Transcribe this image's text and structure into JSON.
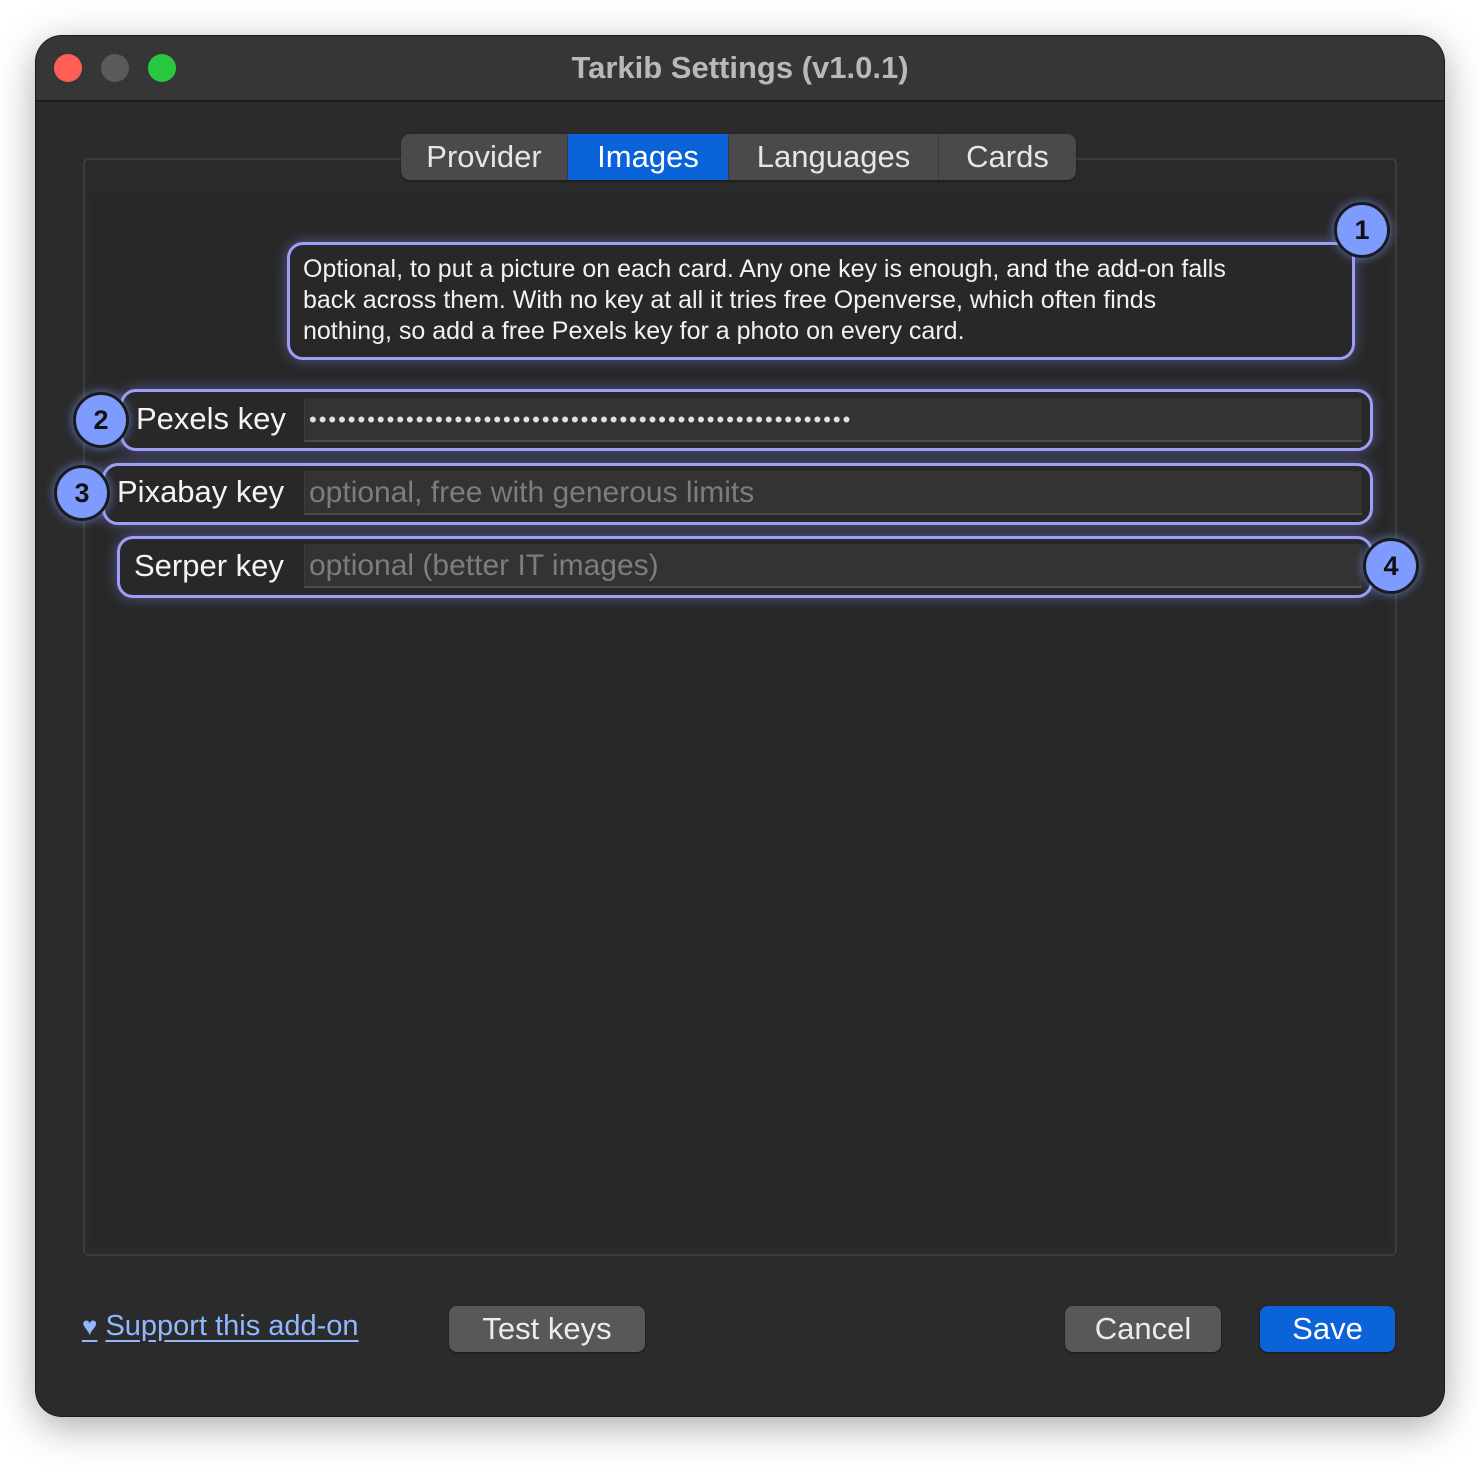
{
  "window": {
    "title": "Tarkib Settings (v1.0.1)"
  },
  "tabs": [
    {
      "label": "Provider",
      "active": false
    },
    {
      "label": "Images",
      "active": true
    },
    {
      "label": "Languages",
      "active": false
    },
    {
      "label": "Cards",
      "active": false
    }
  ],
  "images_tab": {
    "info": "Optional, to put a picture on each card. Any one key is enough, and the add-on falls\nback across them. With no key at all it tries free Openverse, which often finds\nnothing, so add a free Pexels key for a photo on every card.",
    "fields": {
      "pexels": {
        "label": "Pexels key",
        "value": "••••••••••••••••••••••••••••••••••••••••••••••••••••••••",
        "placeholder": ""
      },
      "pixabay": {
        "label": "Pixabay key",
        "value": "",
        "placeholder": "optional, free with generous limits"
      },
      "serper": {
        "label": "Serper key",
        "value": "",
        "placeholder": "optional (better IT images)"
      }
    }
  },
  "annotations": [
    "1",
    "2",
    "3",
    "4"
  ],
  "footer": {
    "support_link": "Support this add-on",
    "support_icon": "heart-icon",
    "test_keys": "Test keys",
    "cancel": "Cancel",
    "save": "Save"
  },
  "colors": {
    "accent": "#0a63d8",
    "callout": "#9d9ef5",
    "badge": "#7e9bff",
    "link": "#8fb8ff"
  }
}
